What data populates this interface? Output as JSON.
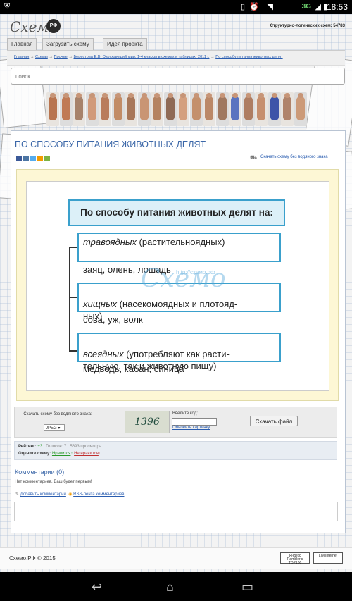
{
  "status_bar": {
    "time": "18:53",
    "network": "3G"
  },
  "header": {
    "logo": "Схемо",
    "logo_badge": "РФ",
    "tagline": "Структурно-логических схем: 54783"
  },
  "nav": {
    "tabs": [
      "Главная",
      "Загрузить схему",
      "Идея проекта"
    ]
  },
  "breadcrumb": {
    "items": [
      "Главная",
      "Схемы",
      "Прочее",
      "Берестова Е.В. Окружающий мир. 1-4 классы в схемах и таблицах. 2011 г.",
      "По способу питания животных делят"
    ],
    "separator": "→"
  },
  "search": {
    "placeholder": "поиск..."
  },
  "photo_strip_colors": [
    "#b8744f",
    "#c07a55",
    "#a7826a",
    "#d19a7a",
    "#b97c5c",
    "#c28c66",
    "#a87759",
    "#c99574",
    "#b58361",
    "#8f6a55",
    "#d4a07f",
    "#c4906c",
    "#bb8867",
    "#a0785f",
    "#5a74c0",
    "#ae7d62",
    "#c68f6e",
    "#3d54a8",
    "#b0836a",
    "#cc9a78"
  ],
  "page": {
    "title": "ПО СПОСОБУ ПИТАНИЯ ЖИВОТНЫХ ДЕЛЯТ",
    "download_no_watermark": "Скачать схему без водяного знака"
  },
  "share_colors": [
    "#3b5998",
    "#4c75a3",
    "#55acee",
    "#f29b00",
    "#7cb342"
  ],
  "scheme": {
    "heading": "По способу питания животных делят на:",
    "boxes": [
      {
        "term": "травоядных",
        "desc": " (растительноядных)"
      },
      {
        "term": "хищных",
        "desc": " (насекомоядных и плотояд-\nных)"
      },
      {
        "term": "всеядных",
        "desc": " (употребляют как расти-\nтельную, так и животную пищу)"
      }
    ],
    "examples": [
      "заяц, олень, лошадь",
      "сова, уж, волк",
      "медведь, кабан, синица"
    ],
    "watermark": "Схемо",
    "watermark_url": "http://схемо.рф"
  },
  "download_panel": {
    "text": "Скачать схему без водяного знака:",
    "format": "JPEG ▾",
    "captcha": "1396",
    "code_label": "Введите код:",
    "refresh": "Обновить картинку",
    "button": "Скачать файл"
  },
  "rating": {
    "label": "Рейтинг:",
    "value": "+3",
    "votes": "Голосов: 7",
    "views": "5693 просмотра",
    "rate_label": "Оцените схему:",
    "like": "Нравится",
    "dislike": "Не нравится"
  },
  "comments": {
    "heading": "Комментарии (0)",
    "empty": "Нет комментариев. Ваш будет первым!",
    "add": "Добавить комментарий",
    "rss": "RSS-лента комментариев"
  },
  "footer": {
    "copyright": "Схемо.РФ © 2015",
    "counter1": "Яндекс Rambler's TOP100",
    "counter2": "LiveInternet"
  }
}
